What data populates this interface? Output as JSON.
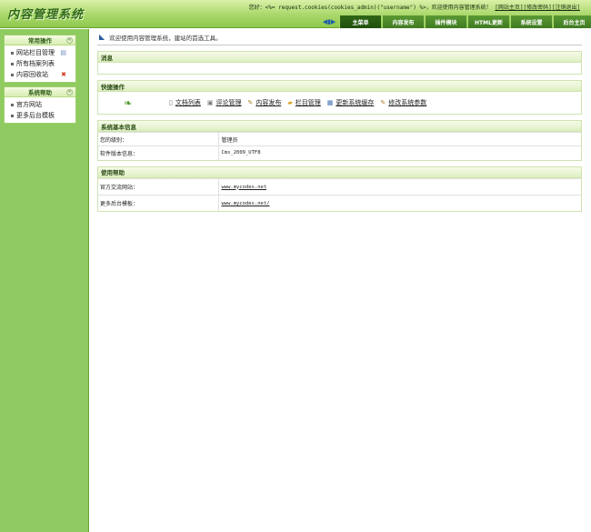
{
  "header": {
    "logo": "内容管理系统",
    "welcome_prefix": "您好：<%= request.cookies(cookies_admin)(\"username\") %>，欢迎使用内容管理系统！",
    "links": [
      "[网站主页]",
      "[修改密码]",
      "[注销退出]"
    ],
    "nav_arrow": "◀▮▶",
    "tabs": [
      "主菜单",
      "内容发布",
      "插件模块",
      "HTML更新",
      "系统设置",
      "后台主页"
    ],
    "accent_color": "#3f7a21"
  },
  "sidebar": {
    "panels": [
      {
        "title": "常用操作",
        "items": [
          {
            "label": "网站栏目管理",
            "icon": "doc-icon"
          },
          {
            "label": "所有档案列表",
            "icon": ""
          },
          {
            "label": "内容回收站",
            "icon": "delete-icon"
          }
        ]
      },
      {
        "title": "系统帮助",
        "items": [
          {
            "label": "官方网站",
            "icon": ""
          },
          {
            "label": "更多后台模板",
            "icon": ""
          }
        ]
      }
    ],
    "collapse_glyph": "«"
  },
  "main": {
    "welcome": "欢迎使用内容管理系统，建站的首选工具。",
    "message_section": {
      "title": "消息"
    },
    "quick_section": {
      "title": "快捷操作",
      "actions": [
        {
          "label": "文档列表",
          "icon": "document-list-icon"
        },
        {
          "label": "评论管理",
          "icon": "comment-icon"
        },
        {
          "label": "内容发布",
          "icon": "pen-icon"
        },
        {
          "label": "栏目管理",
          "icon": "folder-icon"
        },
        {
          "label": "更新系统缓存",
          "icon": "refresh-icon"
        },
        {
          "label": "修改系统参数",
          "icon": "settings-pen-icon"
        }
      ]
    },
    "system_info": {
      "title": "系统基本信息",
      "rows": [
        {
          "key": "您的级别：",
          "value": "管理员"
        },
        {
          "key": "软件版本信息：",
          "value": "Cms_2009_UTF8"
        }
      ]
    },
    "help": {
      "title": "使用帮助",
      "rows": [
        {
          "key": "官方交流网站：",
          "value": "www.mycodes.net"
        },
        {
          "key": "更多后台模板：",
          "value": "www.mycodes.net/"
        }
      ]
    }
  }
}
